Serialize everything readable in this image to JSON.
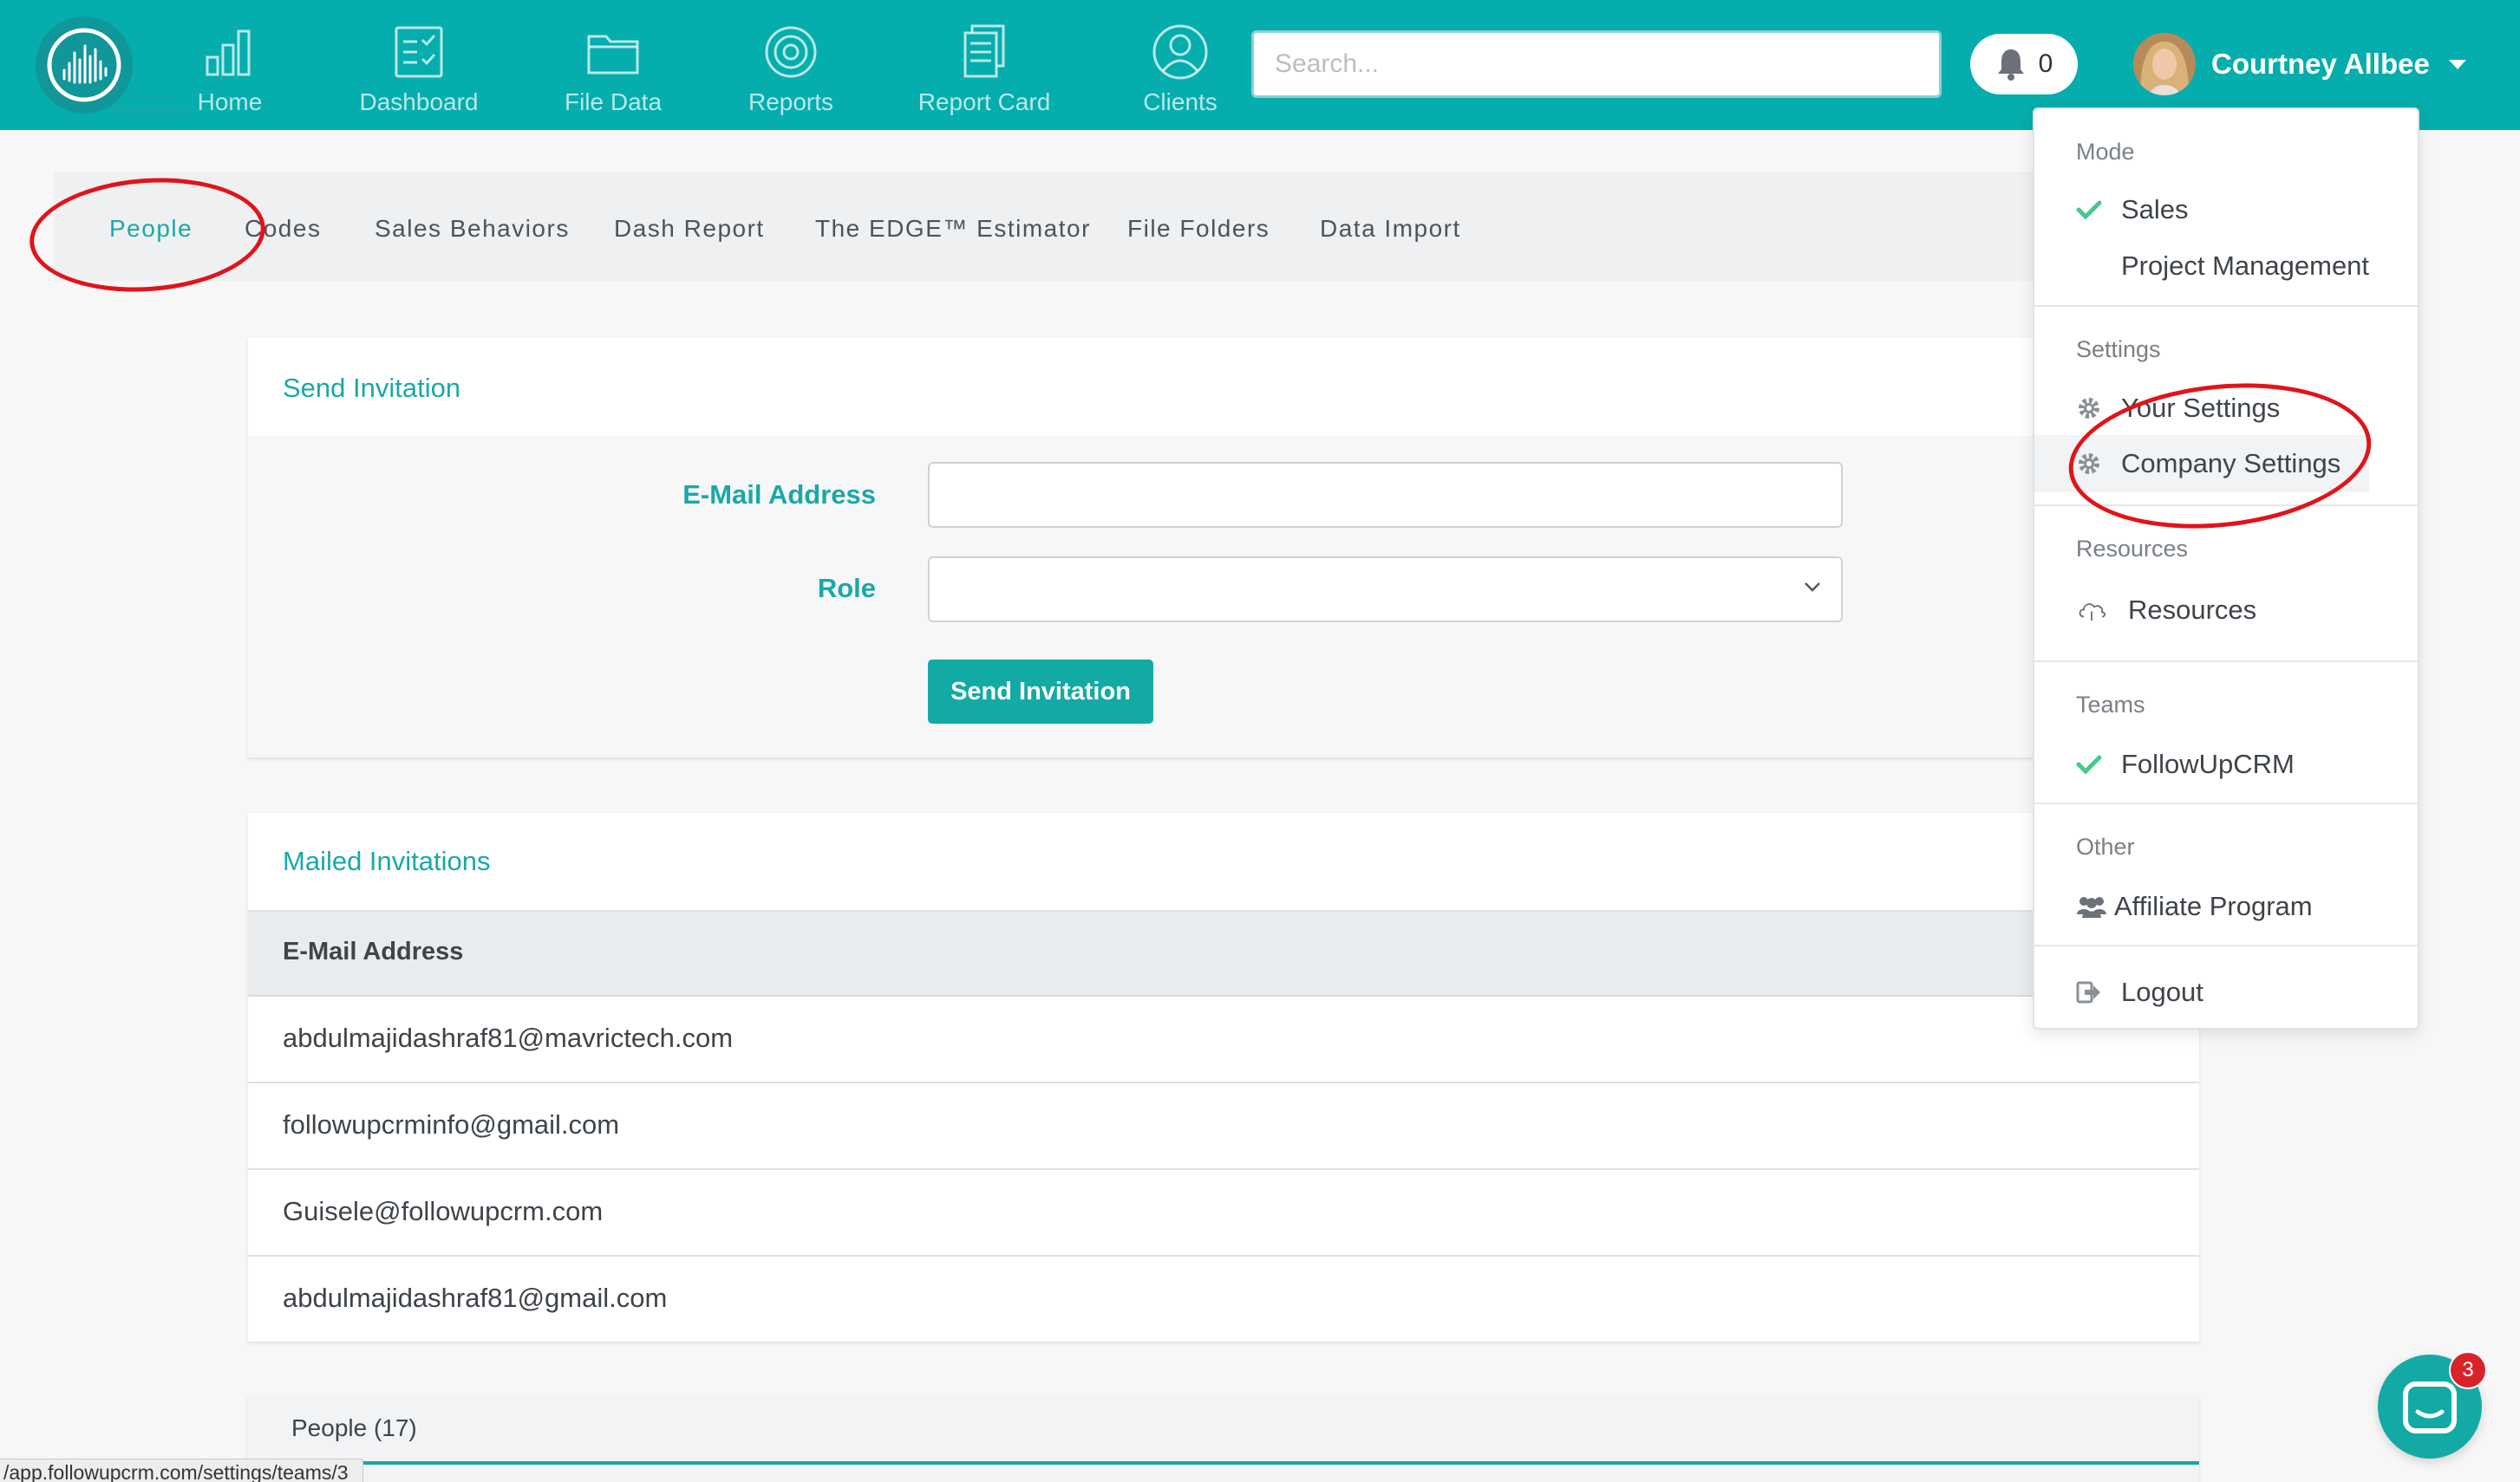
{
  "navbar": {
    "items": [
      {
        "label": "Home",
        "icon": "bar-chart-icon"
      },
      {
        "label": "Dashboard",
        "icon": "clipboard-check-icon"
      },
      {
        "label": "File Data",
        "icon": "folder-icon"
      },
      {
        "label": "Reports",
        "icon": "target-icon"
      },
      {
        "label": "Report Card",
        "icon": "document-stack-icon"
      },
      {
        "label": "Clients",
        "icon": "user-circle-icon"
      }
    ],
    "search_placeholder": "Search...",
    "notifications_count": "0",
    "user_name": "Courtney Allbee",
    "brand_color": "#05adad"
  },
  "tabs": [
    "People",
    "Codes",
    "Sales Behaviors",
    "Dash Report",
    "The EDGE™ Estimator",
    "File Folders",
    "Data Import"
  ],
  "send_invitation": {
    "title": "Send Invitation",
    "email_label": "E-Mail Address",
    "email_value": "",
    "role_label": "Role",
    "role_value": "",
    "button": "Send Invitation"
  },
  "mailed_invitations": {
    "title": "Mailed Invitations",
    "column": "E-Mail Address",
    "rows": [
      "abdulmajidashraf81@mavrictech.com",
      "followupcrminfo@gmail.com",
      "Guisele@followupcrm.com",
      "abdulmajidashraf81@gmail.com"
    ]
  },
  "people": {
    "title": "People (17)"
  },
  "dropdown": {
    "mode_header": "Mode",
    "mode_sales": "Sales",
    "mode_pm": "Project Management",
    "settings_header": "Settings",
    "your_settings": "Your Settings",
    "company_settings": "Company Settings",
    "resources_header": "Resources",
    "resources": "Resources",
    "teams_header": "Teams",
    "team_name": "FollowUpCRM",
    "other_header": "Other",
    "affiliate": "Affiliate Program",
    "logout": "Logout"
  },
  "status_url": "/app.followupcrm.com/settings/teams/3",
  "chat_badge": "3"
}
